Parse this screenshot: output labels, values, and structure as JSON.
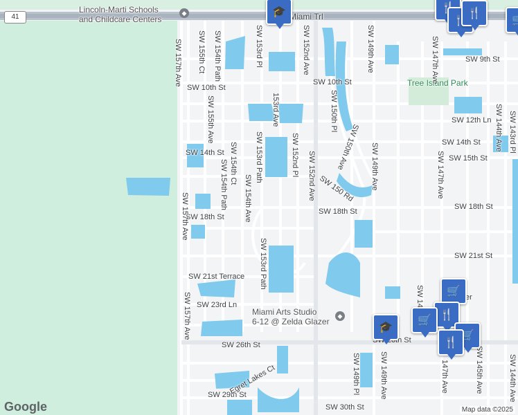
{
  "map": {
    "highway_badge": "41",
    "highway_name": "Miami Trl",
    "park_name": "Tree Island Park",
    "attribution": "Map data ©2025",
    "logo": "Google",
    "streets_h": {
      "sw_10th_st_w": "SW 10th St",
      "sw_10th_st_e": "SW 10th St",
      "sw_9th_st": "SW 9th St",
      "sw_12th_ln": "SW 12th Ln",
      "sw_14th_st_w": "SW 14th St",
      "sw_14th_st_e": "SW 14th St",
      "sw_15th_st": "SW 15th St",
      "sw_18th_st_w": "SW 18th St",
      "sw_18th_st_m": "SW 18th St",
      "sw_18th_st_e": "SW 18th St",
      "sw_21st_terrace": "SW 21st Terrace",
      "sw_21st_st": "SW 21st St",
      "sw_23rd_ln": "SW 23rd Ln",
      "sw_26th_st_w": "SW 26th St",
      "sw_26th_st_e": "SW 26th St",
      "sw_29th_st": "SW 29th St",
      "sw_30th_st": "SW 30th St",
      "sw_150_rd": "SW 150 Rd",
      "egret_lakes_ct": "Egret Lakes Ct",
      "sw_14x": "SW 14",
      "sw_8": "SW 8",
      "sw_26th_partial": "er"
    },
    "streets_v": {
      "sw_157th_ave_a": "SW 157th Ave",
      "sw_157th_ave_b": "SW 157th Ave",
      "sw_157th_ave_c": "SW 157th Ave",
      "sw_155th_ct": "SW 155th Ct",
      "sw_154th_path_a": "SW 154th Path",
      "sw_155th_ave": "SW 155th Ave",
      "sw_154th_ct": "SW 154th Ct",
      "sw_154th_path_b": "SW 154th Path",
      "sw_153rd_pl": "SW 153rd Pl",
      "sw_153rd_ave": "153rd Ave",
      "sw_153rd_path_a": "SW 153rd Path",
      "sw_154th_ave": "SW 154th Ave",
      "sw_152nd_pl": "SW 152nd Pl",
      "sw_152nd_ave_a": "SW 152nd Ave",
      "sw_152nd_ave_b": "SW 152nd Ave",
      "sw_153rd_path_b": "SW 153rd Path",
      "sw_150th_pl": "SW 150th Pl",
      "sw_150th_ave": "SW 150th Ave",
      "sw_149th_ave_a": "SW 149th Ave",
      "sw_149th_ave_b": "SW 149th Ave",
      "sw_149th_ave_c": "SW 149th Ave",
      "sw_149th_pl": "SW 149th Pl",
      "sw_147th_ave_a": "SW 147th Ave",
      "sw_147th_ave_b": "SW 147th Ave",
      "sw_147th_ave_c": "147th Ave",
      "sw_145th_ave": "SW 145th Ave",
      "sw_144th_ave": "SW 144th Ave",
      "sw_143rd_pl": "SW 143rd Pl",
      "sw_144th_ave_b": "SW 144th Ave"
    },
    "poi": {
      "lincoln_marti_line1": "Lincoln-Marti Schools",
      "lincoln_marti_line2": "and Childcare Centers",
      "miami_arts_line1": "Miami Arts Studio",
      "miami_arts_line2": "6-12 @ Zelda Glazer"
    },
    "icons": [
      "school-pin",
      "restaurant-pin",
      "shopping-pin",
      "poi-dot"
    ]
  }
}
